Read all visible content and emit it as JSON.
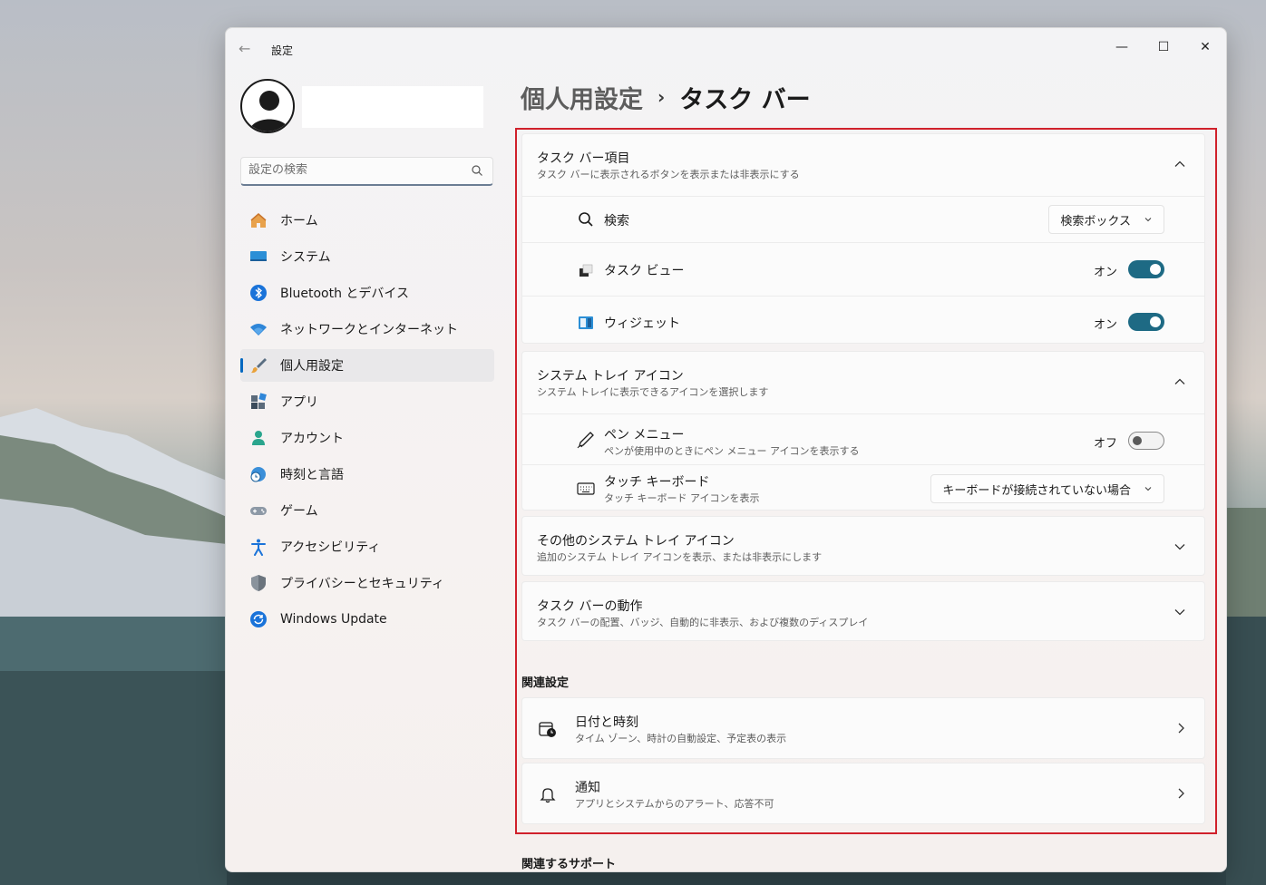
{
  "window": {
    "title": "設定",
    "controls": {
      "minimize": "—",
      "maximize": "☐",
      "close": "✕"
    }
  },
  "sidebar": {
    "search_placeholder": "設定の検索",
    "items": [
      {
        "label": "ホーム",
        "icon": "home-icon"
      },
      {
        "label": "システム",
        "icon": "system-icon"
      },
      {
        "label": "Bluetooth とデバイス",
        "icon": "bluetooth-icon"
      },
      {
        "label": "ネットワークとインターネット",
        "icon": "wifi-icon"
      },
      {
        "label": "個人用設定",
        "icon": "brush-icon",
        "selected": true
      },
      {
        "label": "アプリ",
        "icon": "apps-icon"
      },
      {
        "label": "アカウント",
        "icon": "account-icon"
      },
      {
        "label": "時刻と言語",
        "icon": "globe-clock-icon"
      },
      {
        "label": "ゲーム",
        "icon": "gamepad-icon"
      },
      {
        "label": "アクセシビリティ",
        "icon": "accessibility-icon"
      },
      {
        "label": "プライバシーとセキュリティ",
        "icon": "shield-icon"
      },
      {
        "label": "Windows Update",
        "icon": "update-icon"
      }
    ]
  },
  "breadcrumb": {
    "parent": "個人用設定",
    "separator": "›",
    "current": "タスク バー"
  },
  "taskbar_items": {
    "title": "タスク バー項目",
    "description": "タスク バーに表示されるボタンを表示または非表示にする",
    "search": {
      "label": "検索",
      "value": "検索ボックス"
    },
    "task_view": {
      "label": "タスク ビュー",
      "state": "オン"
    },
    "widgets": {
      "label": "ウィジェット",
      "state": "オン"
    }
  },
  "system_tray": {
    "title": "システム トレイ アイコン",
    "description": "システム トレイに表示できるアイコンを選択します",
    "pen_menu": {
      "label": "ペン メニュー",
      "description": "ペンが使用中のときにペン メニュー アイコンを表示する",
      "state": "オフ"
    },
    "touch_keyboard": {
      "label": "タッチ キーボード",
      "description": "タッチ キーボード アイコンを表示",
      "value": "キーボードが接続されていない場合"
    }
  },
  "other_tray": {
    "title": "その他のシステム トレイ アイコン",
    "description": "追加のシステム トレイ アイコンを表示、または非表示にします"
  },
  "behaviors": {
    "title": "タスク バーの動作",
    "description": "タスク バーの配置、バッジ、自動的に非表示、および複数のディスプレイ"
  },
  "related": {
    "heading": "関連設定",
    "links": [
      {
        "title": "日付と時刻",
        "description": "タイム ゾーン、時計の自動設定、予定表の表示",
        "icon": "calendar-clock-icon"
      },
      {
        "title": "通知",
        "description": "アプリとシステムからのアラート、応答不可",
        "icon": "bell-icon"
      }
    ]
  },
  "support_heading": "関連するサポート",
  "colors": {
    "accent": "#0067c0",
    "toggle_on": "#1e6a84",
    "highlight": "#d0212b"
  }
}
